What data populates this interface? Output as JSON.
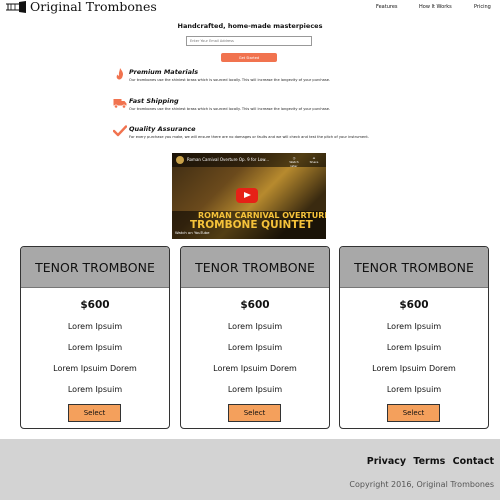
{
  "header": {
    "brand": "Original Trombones",
    "nav": [
      "Features",
      "How It Works",
      "Pricing"
    ]
  },
  "hero": {
    "title": "Handcrafted, home-made masterpieces",
    "email_placeholder": "Enter Your Email Address",
    "submit_label": "Get Started"
  },
  "features": [
    {
      "icon": "fire-icon",
      "title": "Premium Materials",
      "desc": "Our trombones use the shiniest brass which is sourced locally. This will increase the longevity of your purchase."
    },
    {
      "icon": "truck-icon",
      "title": "Fast Shipping",
      "desc": "Our trombones use the shiniest brass which is sourced locally. This will increase the longevity of your purchase."
    },
    {
      "icon": "check-icon",
      "title": "Quality Assurance",
      "desc": "For every purchase you make, we will ensure there are no damages or faults and we will check and test the pitch of your instrument."
    }
  ],
  "video": {
    "title": "Roman Carnival Overture Op. 9 for Low...",
    "watch_later": "Watch later",
    "share": "Share",
    "line1": "ROMAN CARNIVAL OVERTURE",
    "line2": "TROMBONE QUINTET",
    "watch_on": "Watch on YouTube"
  },
  "pricing": [
    {
      "name": "TENOR TROMBONE",
      "price": "$600",
      "features": [
        "Lorem Ipsuim",
        "Lorem Ipsuim",
        "Lorem Ipsuim Dorem",
        "Lorem Ipsuim"
      ],
      "button": "Select"
    },
    {
      "name": "TENOR TROMBONE",
      "price": "$600",
      "features": [
        "Lorem Ipsuim",
        "Lorem Ipsuim",
        "Lorem Ipsuim Dorem",
        "Lorem Ipsuim"
      ],
      "button": "Select"
    },
    {
      "name": "TENOR TROMBONE",
      "price": "$600",
      "features": [
        "Lorem Ipsuim",
        "Lorem Ipsuim",
        "Lorem Ipsuim Dorem",
        "Lorem Ipsuim"
      ],
      "button": "Select"
    }
  ],
  "footer": {
    "links": [
      "Privacy",
      "Terms",
      "Contact"
    ],
    "copyright": "Copyright 2016, Original Trombones"
  },
  "colors": {
    "accent": "#f1734f",
    "select_button": "#f4a05c",
    "card_header": "#a8a8a8",
    "footer_bg": "#d3d3d3"
  }
}
